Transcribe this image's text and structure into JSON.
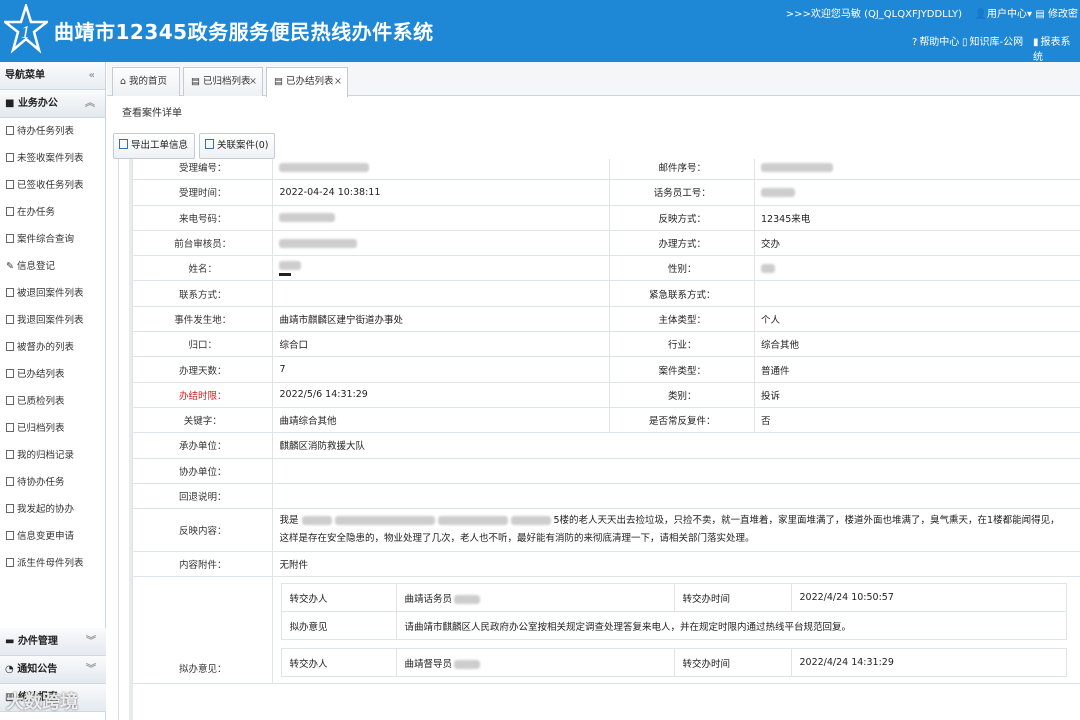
{
  "header": {
    "title": "曲靖市12345政务服务便民热线办件系统",
    "welcome": ">>>欢迎您马敏 (QJ_QLQXFJYDDLLY)",
    "user_center": "用户中心",
    "change_password": "修改密",
    "links": [
      {
        "label": "帮助中心",
        "icon": "help-icon"
      },
      {
        "label": "知识库-公网",
        "icon": "knowledge-icon"
      },
      {
        "label": "报表系统",
        "icon": "report-icon"
      }
    ]
  },
  "sidebar": {
    "title": "导航菜单",
    "group_business": "业务办公",
    "items": [
      {
        "label": "待办任务列表",
        "icon": "list-icon"
      },
      {
        "label": "未签收案件列表",
        "icon": "list-icon"
      },
      {
        "label": "已签收任务列表",
        "icon": "list-icon"
      },
      {
        "label": "在办任务",
        "icon": "list-icon"
      },
      {
        "label": "案件综合查询",
        "icon": "list-icon"
      },
      {
        "label": "信息登记",
        "icon": "pencil-icon"
      },
      {
        "label": "被退回案件列表",
        "icon": "list-icon"
      },
      {
        "label": "我退回案件列表",
        "icon": "list-icon"
      },
      {
        "label": "被督办的列表",
        "icon": "list-icon"
      },
      {
        "label": "已办结列表",
        "icon": "list-icon"
      },
      {
        "label": "已质检列表",
        "icon": "list-icon"
      },
      {
        "label": "已归档列表",
        "icon": "list-icon"
      },
      {
        "label": "我的归档记录",
        "icon": "list-icon"
      },
      {
        "label": "待协办任务",
        "icon": "list-icon"
      },
      {
        "label": "我发起的协办",
        "icon": "list-icon"
      },
      {
        "label": "信息变更申请",
        "icon": "list-icon"
      },
      {
        "label": "派生件母件列表",
        "icon": "list-icon"
      }
    ],
    "group_manage": "办件管理",
    "group_notice": "通知公告",
    "group_stats": "统计报表"
  },
  "tabs": [
    {
      "label": "我的首页",
      "icon": "home-icon"
    },
    {
      "label": "已归档列表",
      "icon": "list-icon"
    },
    {
      "label": "已办结列表",
      "icon": "list-icon"
    }
  ],
  "breadcrumb": "查看案件详单",
  "toolbar": {
    "export_label": "导出工单信息",
    "related_label": "关联案件(0)"
  },
  "detail": {
    "rows": [
      {
        "l1": "受理编号：",
        "v1": "",
        "l2": "邮件序号：",
        "v2": ""
      },
      {
        "l1": "受理时间：",
        "v1": "2022-04-24 10:38:11",
        "l2": "话务员工号：",
        "v2": ""
      },
      {
        "l1": "来电号码：",
        "v1": "",
        "l2": "反映方式：",
        "v2": "12345来电"
      },
      {
        "l1": "前台审核员：",
        "v1": "",
        "l2": "办理方式：",
        "v2": "交办"
      },
      {
        "l1": "姓名：",
        "v1": "",
        "l2": "性别：",
        "v2": ""
      },
      {
        "l1": "联系方式：",
        "v1": "",
        "l2": "紧急联系方式：",
        "v2": ""
      },
      {
        "l1": "事件发生地：",
        "v1": "曲靖市麒麟区建宁街道办事处",
        "l2": "主体类型：",
        "v2": "个人"
      },
      {
        "l1": "归口：",
        "v1": "综合口",
        "l2": "行业：",
        "v2": "综合其他"
      },
      {
        "l1": "办理天数：",
        "v1": "7",
        "l2": "案件类型：",
        "v2": "普通件"
      },
      {
        "l1": "办结时限：",
        "v1": "2022/5/6 14:31:29",
        "l2": "类别：",
        "v2": "投诉"
      },
      {
        "l1": "关键字：",
        "v1": "曲靖综合其他",
        "l2": "是否常反复件：",
        "v2": "否"
      }
    ],
    "undertake_label": "承办单位：",
    "undertake_value": "麒麟区消防救援大队",
    "assist_label": "协办单位：",
    "return_label": "回退说明：",
    "content_label": "反映内容：",
    "content_line1_pre": "我是",
    "content_line1_post": "5楼的老人天天出去捡垃圾，只捡不卖，就一直堆着，家里面堆满了，楼道外面也堆满了，臭气熏天，在1楼都能闻得见，",
    "content_line2": "这样是存在安全隐患的，物业处理了几次，老人也不听，最好能有消防的来彻底清理一下，请相关部门落实处理。",
    "attach_label": "内容附件：",
    "attach_value": "无附件",
    "opinion_label": "拟办意见：",
    "transfers": [
      {
        "by_label": "转交办人",
        "by_value": "曲靖话务员",
        "time_label": "转交办时间",
        "time_value": "2022/4/24 10:50:57",
        "op_label": "拟办意见",
        "op_value": "请曲靖市麒麟区人民政府办公室按相关规定调查处理答复来电人，并在规定时限内通过热线平台规范回复。"
      },
      {
        "by_label": "转交办人",
        "by_value": "曲靖督导员",
        "time_label": "转交办时间",
        "time_value": "2022/4/24 14:31:29"
      }
    ]
  },
  "watermark": "大数跨境"
}
